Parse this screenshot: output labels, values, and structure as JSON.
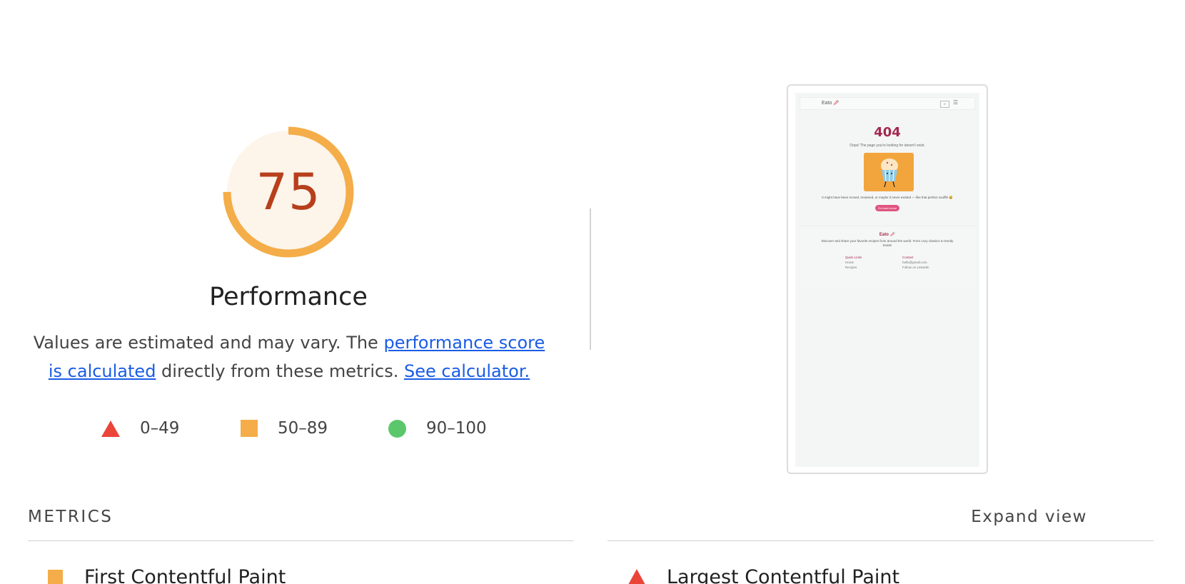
{
  "score": {
    "value": "75",
    "percent": 75,
    "title": "Performance",
    "ring_color": "#f4ad48",
    "fill_color": "#fdf4ea",
    "text_color": "#b73f1c"
  },
  "description": {
    "prefix": "Values are estimated and may vary. The ",
    "link1": "performance score is calculated",
    "middle": " directly from these metrics. ",
    "link2": "See calculator."
  },
  "legend": [
    {
      "shape": "triangle-icon",
      "range": "0–49",
      "color": "#eb4438"
    },
    {
      "shape": "square-icon",
      "range": "50–89",
      "color": "#f4ad48"
    },
    {
      "shape": "circle-icon",
      "range": "90–100",
      "color": "#5bc76b"
    }
  ],
  "thumbnail": {
    "brand": "Eato 🥢",
    "heading": "404",
    "oops": "Oops! The page you're looking for doesn't exist.",
    "message": "It might have been moved, renamed, or maybe it never existed — like that perfect soufflé 😅",
    "button": "Go back home",
    "footer_brand": "Eato 🥢",
    "footer_desc": "Discover and share your favorite recipes from around the world. From cozy classics to trendy treats!",
    "quick_links_title": "Quick Links",
    "quick_links": [
      "Home",
      "Recipes"
    ],
    "contact_title": "Contact",
    "contact_items": [
      "hello@gmail.com",
      "Follow on LinkedIn"
    ]
  },
  "metrics": {
    "title": "METRICS",
    "expand": "Expand view",
    "items": [
      {
        "label": "First Contentful Paint",
        "status": "square-icon"
      },
      {
        "label": "Largest Contentful Paint",
        "status": "triangle-icon"
      }
    ]
  }
}
